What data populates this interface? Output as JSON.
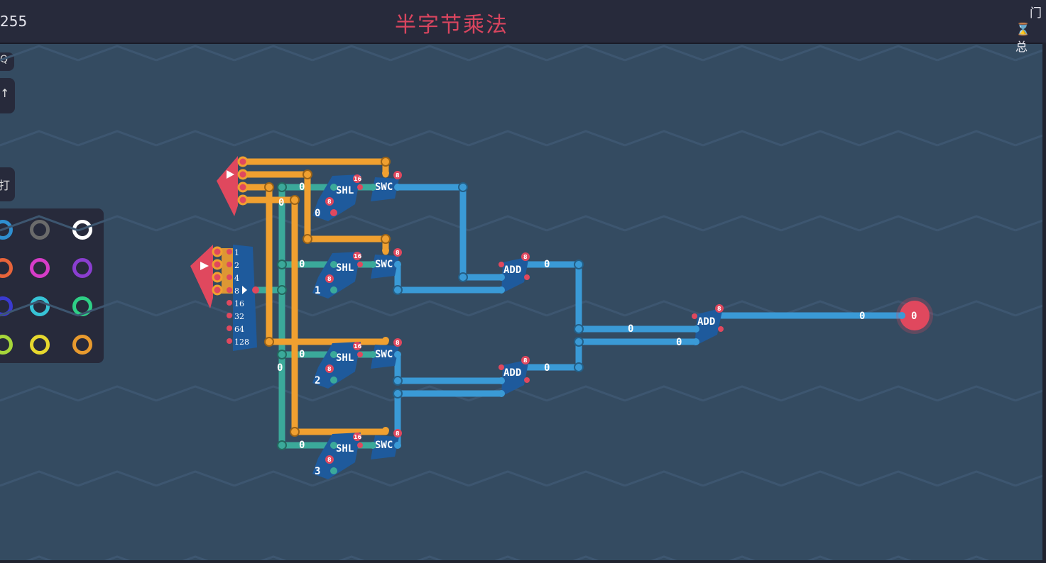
{
  "header": {
    "count": "255",
    "title": "半字节乘法",
    "gate_label": "门",
    "total_label": "总",
    "hourglass": "hourglass-icon"
  },
  "toolbar": {
    "btn1": "Q",
    "btn2": "↑",
    "btn3": "打"
  },
  "palette": {
    "colors": [
      "#2f8fd0",
      "#6b6b6b",
      "#ffffff",
      "#e8643a",
      "#d63cc8",
      "#8a3ed0",
      "#3a3ad0",
      "#37c3d6",
      "#2ecf86",
      "#a6d63a",
      "#e6d82e",
      "#e89a2e"
    ]
  },
  "circuit": {
    "shl_label": "SHL",
    "swc_label": "SWC",
    "add_label": "ADD",
    "badge_8": "8",
    "badge_16": "16",
    "shift_amounts": [
      "0",
      "1",
      "2",
      "3"
    ],
    "wire_value": "0",
    "output_value": "0",
    "splitter_bits": [
      "1",
      "2",
      "4",
      "8",
      "16",
      "32",
      "64",
      "128"
    ]
  },
  "colors": {
    "orange_wire": "#f0a030",
    "teal_wire": "#3ba99a",
    "blue_wire": "#3a9ad6",
    "red_component": "#e0485e",
    "component_blue": "#1e5a9c"
  }
}
